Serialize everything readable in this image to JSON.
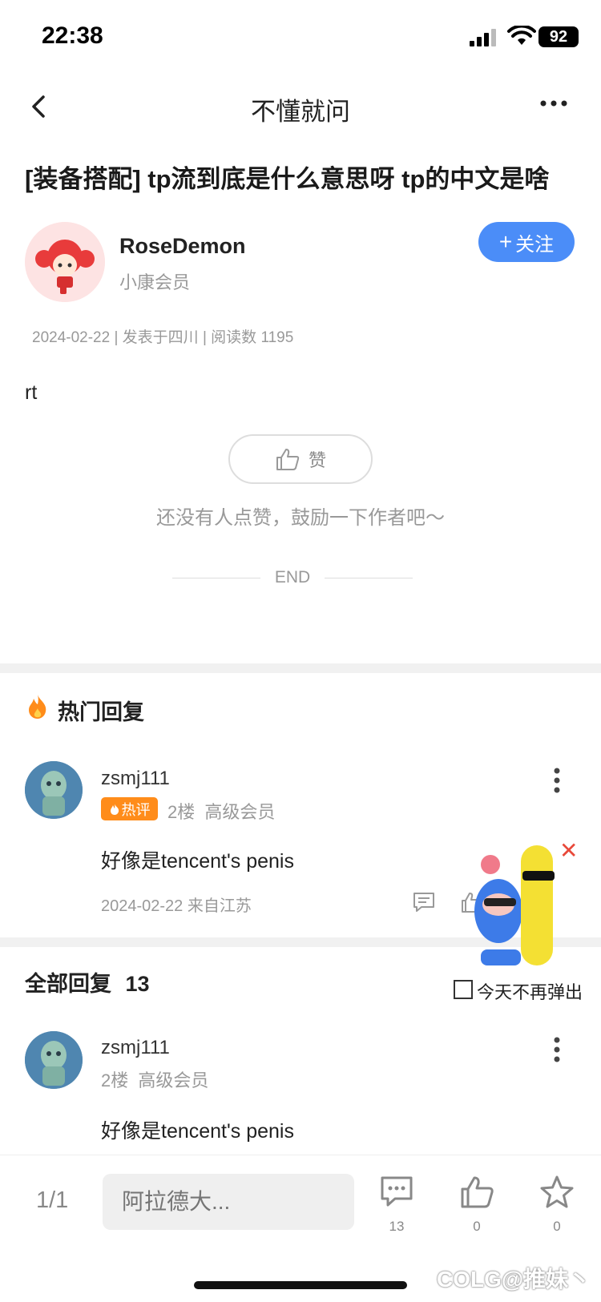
{
  "status_bar": {
    "time": "22:38",
    "battery": "92"
  },
  "nav": {
    "title": "不懂就问"
  },
  "post": {
    "title": "[装备搭配] tp流到底是什么意思呀 tp的中文是啥",
    "author": {
      "name": "RoseDemon",
      "level": "小康会员"
    },
    "follow_label": "关注",
    "meta": "2024-02-22 | 发表于四川 | 阅读数 1195",
    "body": "rt",
    "like_label": "赞",
    "like_hint": "还没有人点赞，鼓励一下作者吧～",
    "end_label": "END"
  },
  "hot_replies": {
    "title": "热门回复",
    "items": [
      {
        "username": "zsmj111",
        "badge": "热评",
        "floor": "2楼",
        "level": "高级会员",
        "text": "好像是tencent's penis",
        "date": "2024-02-22 来自江苏"
      }
    ]
  },
  "all_replies": {
    "title": "全部回复",
    "count": "13",
    "items": [
      {
        "username": "zsmj111",
        "floor": "2楼",
        "level": "高级会员",
        "text": "好像是tencent's penis"
      }
    ]
  },
  "popup": {
    "dont_show_today": "今天不再弹出"
  },
  "bottom_bar": {
    "page": "1/1",
    "input_placeholder": "阿拉德大...",
    "comment_count": "13",
    "like_count": "0",
    "fav_count": "0"
  },
  "watermark": "COLG@推妹丶",
  "colors": {
    "accent": "#4b8df8",
    "hot": "#ff8c1a",
    "close": "#e8493a"
  }
}
